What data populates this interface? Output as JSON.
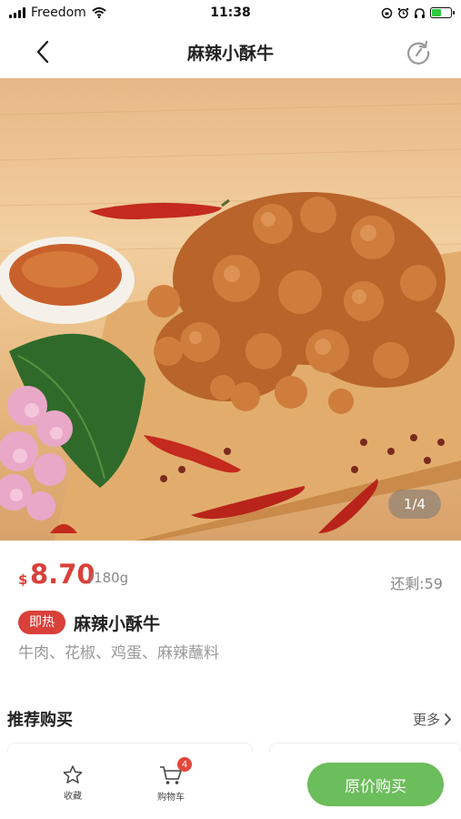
{
  "status_bar": {
    "carrier": "Freedom",
    "time": "11:38",
    "icons": [
      "signal-icon",
      "wifi-icon",
      "lock-rotation-icon",
      "alarm-icon",
      "headphones-icon",
      "battery-charging-icon"
    ]
  },
  "nav": {
    "title": "麻辣小酥牛",
    "back_icon": "chevron-left-icon",
    "refresh_icon": "refresh-icon"
  },
  "gallery": {
    "indicator": "1/4"
  },
  "product": {
    "currency": "$",
    "price": "8.70",
    "unit": "/180g",
    "stock": "还剩:59",
    "tag": "即热",
    "name": "麻辣小酥牛",
    "ingredients": "牛肉、花椒、鸡蛋、麻辣蘸料"
  },
  "recommend": {
    "title": "推荐购买",
    "more": "更多"
  },
  "bottom_bar": {
    "favorite_label": "收藏",
    "cart_label": "购物车",
    "cart_count": "4",
    "buy_label": "原价购买"
  },
  "colors": {
    "accent_red": "#d9403a",
    "buy_green": "#6cbd5b"
  }
}
